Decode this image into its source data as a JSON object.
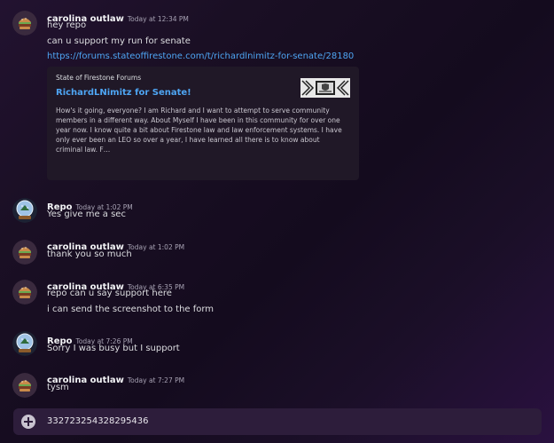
{
  "messages": [
    {
      "author": "carolina outlaw",
      "time": "Today at 12:34 PM",
      "avatar": "burger-avatar-icon",
      "lines": [
        "hey repo",
        "can u support my run for senate"
      ],
      "link": "https://forums.stateoffirestone.com/t/richardlnimitz-for-senate/28180",
      "embed": {
        "provider": "State of Firestone Forums",
        "title": "RichardLNimitz for Senate!",
        "description": "How's it going, everyone? I am Richard and I want to attempt to serve community members in a different way. About Myself I have been in this community for over one year now. I know quite a bit about Firestone law and law enforcement systems. I have only ever been an LEO so over a year, I have learned all there is to know about criminal law. F…",
        "thumbnail": "forum-logo-icon"
      }
    },
    {
      "author": "Repo",
      "time": "Today at 1:02 PM",
      "avatar": "snow-globe-avatar-icon",
      "lines": [
        "Yes give me a sec"
      ]
    },
    {
      "author": "carolina outlaw",
      "time": "Today at 1:02 PM",
      "avatar": "burger-avatar-icon",
      "lines": [
        "thank you so much"
      ]
    },
    {
      "author": "carolina outlaw",
      "time": "Today at 6:35 PM",
      "avatar": "burger-avatar-icon",
      "lines": [
        "repo can u say support here",
        "i can send the screenshot to the form"
      ]
    },
    {
      "author": "Repo",
      "time": "Today at 7:26 PM",
      "avatar": "snow-globe-avatar-icon",
      "lines": [
        "Sorry I was busy but I support"
      ]
    },
    {
      "author": "carolina outlaw",
      "time": "Today at 7:27 PM",
      "avatar": "burger-avatar-icon",
      "lines": [
        "tysm"
      ]
    }
  ],
  "composer": {
    "value": "332723254328295436",
    "icon": "add-attachment-icon"
  },
  "colors": {
    "link": "#4ea5f3",
    "author": "#f2f3f5",
    "timestamp": "#a7a2b3",
    "embed_bg": "#201827",
    "composer_bg": "#2d1d3b"
  }
}
